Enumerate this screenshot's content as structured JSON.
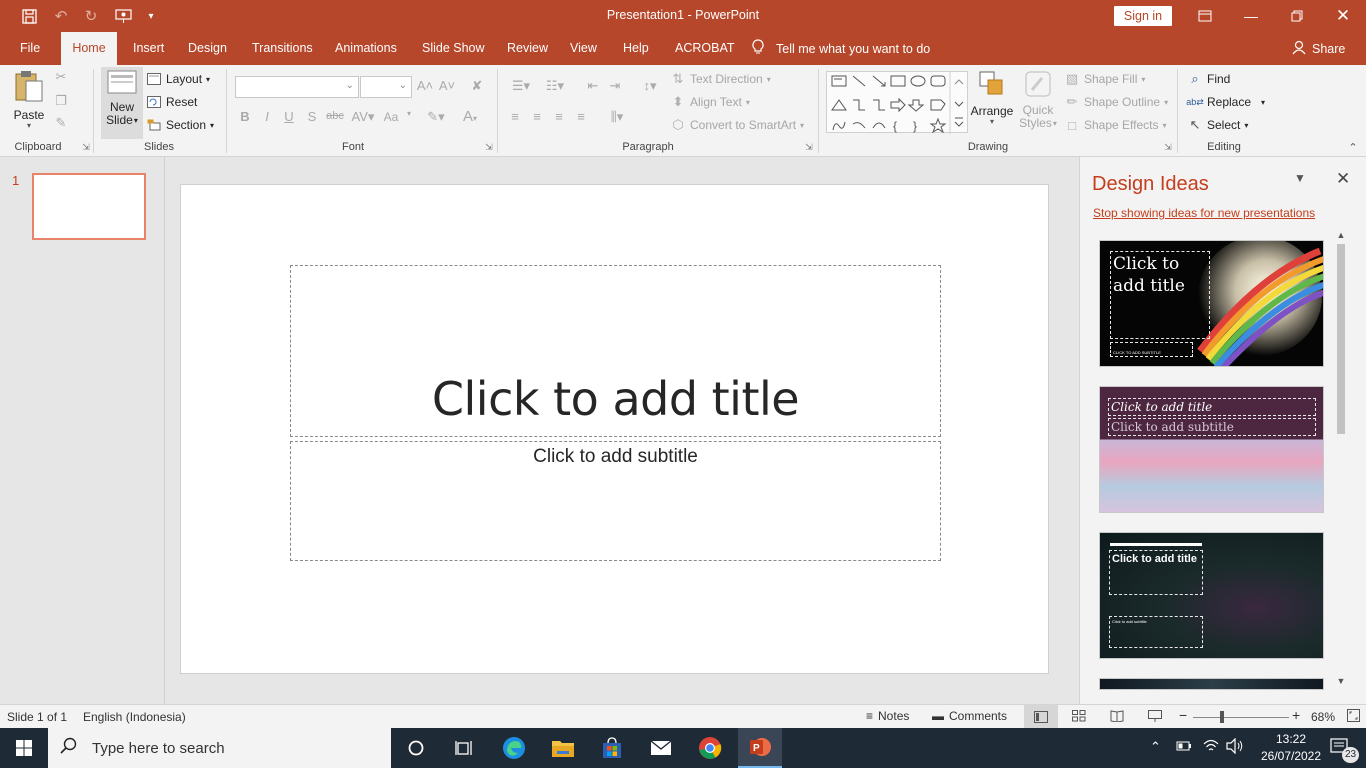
{
  "window": {
    "title": "Presentation1  -  PowerPoint",
    "signin_label": "Sign in"
  },
  "tabs": {
    "items": [
      "File",
      "Home",
      "Insert",
      "Design",
      "Transitions",
      "Animations",
      "Slide Show",
      "Review",
      "View",
      "Help",
      "ACROBAT"
    ],
    "active": "Home",
    "tellme": "Tell me what you want to do",
    "share": "Share"
  },
  "ribbon": {
    "clipboard": {
      "label": "Clipboard",
      "paste": "Paste"
    },
    "slides": {
      "label": "Slides",
      "new_slide_1": "New",
      "new_slide_2": "Slide",
      "layout": "Layout",
      "reset": "Reset",
      "section": "Section"
    },
    "font": {
      "label": "Font",
      "bold": "B",
      "italic": "I",
      "underline": "U",
      "shadow": "S",
      "strike": "abc",
      "case": "Aa"
    },
    "paragraph": {
      "label": "Paragraph",
      "text_direction": "Text Direction",
      "align_text": "Align Text",
      "convert_smartart": "Convert to SmartArt"
    },
    "drawing": {
      "label": "Drawing",
      "arrange": "Arrange",
      "quick_styles_1": "Quick",
      "quick_styles_2": "Styles",
      "shape_fill": "Shape Fill",
      "shape_outline": "Shape Outline",
      "shape_effects": "Shape Effects"
    },
    "editing": {
      "label": "Editing",
      "find": "Find",
      "replace": "Replace",
      "select": "Select"
    }
  },
  "thumbnails": {
    "slide_number": "1"
  },
  "slide": {
    "title_placeholder": "Click to add title",
    "subtitle_placeholder": "Click to add subtitle"
  },
  "design_ideas": {
    "title": "Design Ideas",
    "stop_link": "Stop showing ideas for new presentations",
    "idea1_title": "Click to add title",
    "idea1_subtitle": "CLICK TO ADD SUBTITLE",
    "idea2_title": "Click to add title",
    "idea2_subtitle": "Click to add subtitle",
    "idea3_title": "Click to add title",
    "idea3_subtitle": "Click to add subtitle"
  },
  "statusbar": {
    "slide_info": "Slide 1 of 1",
    "language": "English (Indonesia)",
    "notes": "Notes",
    "comments": "Comments",
    "zoom": "68%"
  },
  "taskbar": {
    "search_placeholder": "Type here to search",
    "time": "13:22",
    "date": "26/07/2022",
    "notification_count": "23"
  }
}
